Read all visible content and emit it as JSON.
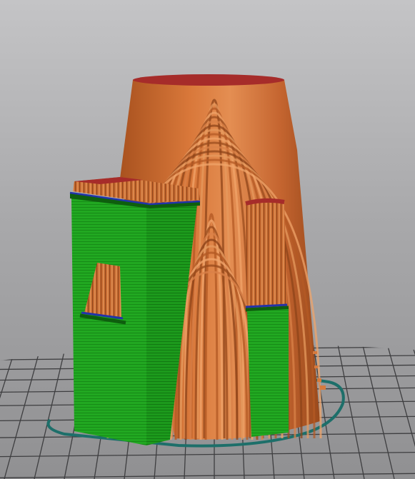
{
  "viewport": {
    "kind": "3D slicer preview",
    "background_top": "#c4c4c6",
    "background_bottom": "#909092"
  },
  "colors": {
    "perimeter_orange": "#c8662d",
    "perimeter_orange_light": "#e08a4c",
    "perimeter_orange_dark": "#8e4419",
    "top_solid_red": "#a62c2a",
    "solid_infill_green": "#1fa51f",
    "solid_infill_green_dark": "#137a13",
    "overhang_blue": "#2233aa",
    "skirt_teal": "#1d6f6a",
    "bed_grid": "#4a4a4c"
  },
  "legend_icons": [
    "bed-grid-icon",
    "skirt-outline-icon"
  ]
}
